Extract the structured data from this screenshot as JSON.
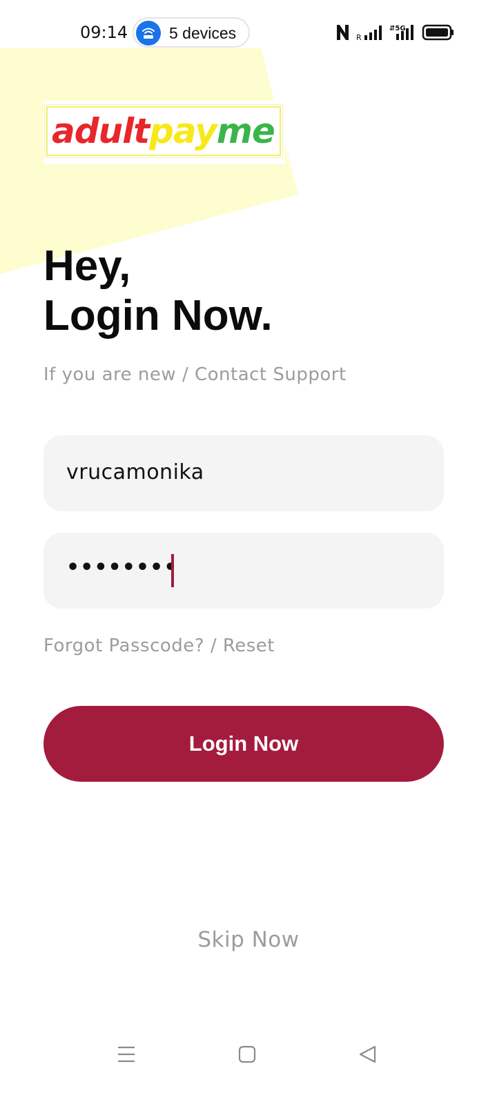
{
  "status_bar": {
    "time": "09:14",
    "hotspot_label": "5 devices",
    "icons": [
      "nfc-icon",
      "roaming-signal-icon",
      "5g-signal-icon",
      "battery-icon"
    ]
  },
  "logo": {
    "part1": "adult",
    "part2": "pay",
    "part3": "me",
    "colors": {
      "part1": "#e8262b",
      "part2": "#f7e81a",
      "part3": "#3ab54a"
    }
  },
  "heading": {
    "line1": "Hey,",
    "line2": "Login Now."
  },
  "subtext": "If you are new / Contact Support",
  "form": {
    "username_value": "vrucamonika",
    "password_value": "••••••••"
  },
  "forgot_link": "Forgot Passcode? / Reset",
  "login_button_label": "Login Now",
  "skip_label": "Skip Now",
  "nav": {
    "icons": [
      "menu-icon",
      "home-icon",
      "back-icon"
    ]
  },
  "colors": {
    "accent": "#a41c3d",
    "decor_yellow": "#fefdd0",
    "muted_text": "#9c9c9c",
    "field_bg": "#f4f4f4"
  }
}
